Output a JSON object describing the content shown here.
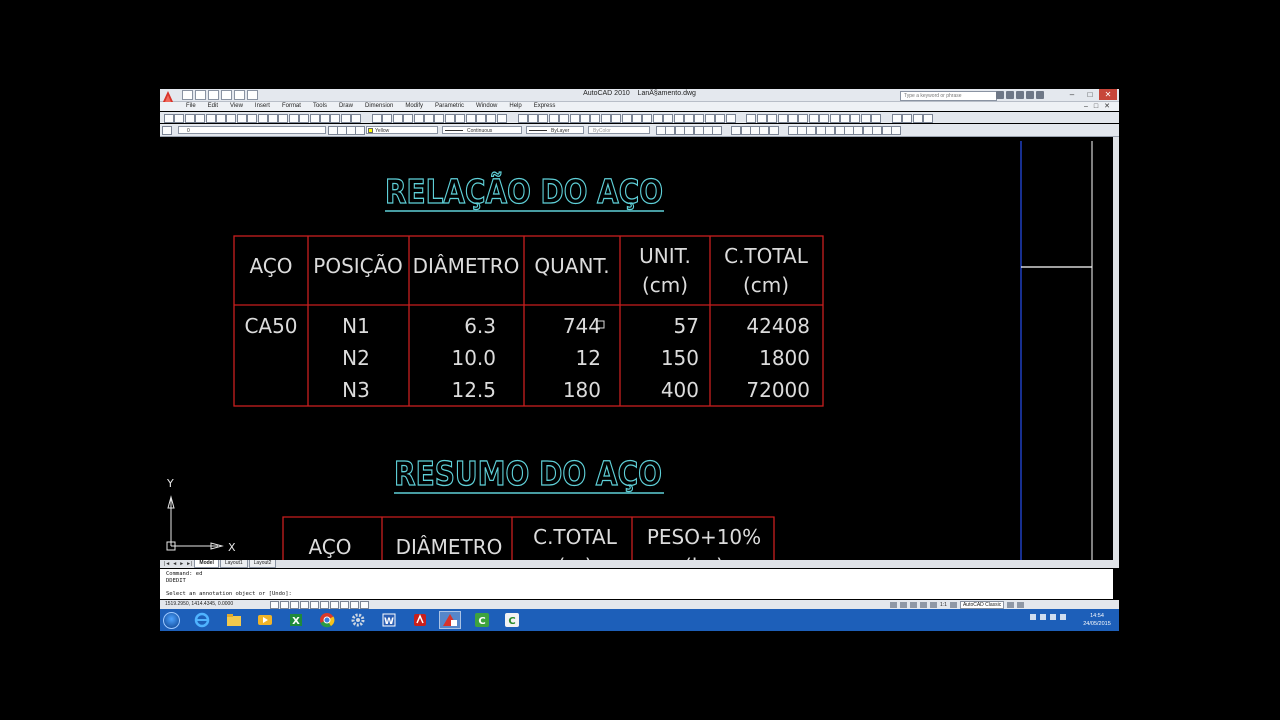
{
  "window": {
    "title": "AutoCAD 2010",
    "document": "LanÃ§amento.dwg"
  },
  "help_search": {
    "placeholder": "Type a keyword or phrase"
  },
  "menu": [
    "File",
    "Edit",
    "View",
    "Insert",
    "Format",
    "Tools",
    "Draw",
    "Dimension",
    "Modify",
    "Parametric",
    "Window",
    "Help",
    "Express"
  ],
  "properties": {
    "layer": "0",
    "color": "Yellow",
    "linetype": "Continuous",
    "lineweight": "ByLayer",
    "plotstyle": "ByColor"
  },
  "table1": {
    "title": "RELAÇÃO DO AÇO",
    "headers": [
      [
        "AÇO"
      ],
      [
        "POSIÇÃO"
      ],
      [
        "DIÂMETRO"
      ],
      [
        "QUANT."
      ],
      [
        "UNIT.",
        "(cm)"
      ],
      [
        "C.TOTAL",
        "(cm)"
      ]
    ],
    "steel": "CA50",
    "rows": [
      {
        "pos": "N1",
        "diam": "6.3",
        "quant": "744",
        "unit": "57",
        "total": "42408"
      },
      {
        "pos": "N2",
        "diam": "10.0",
        "quant": "12",
        "unit": "150",
        "total": "1800"
      },
      {
        "pos": "N3",
        "diam": "12.5",
        "quant": "180",
        "unit": "400",
        "total": "72000"
      }
    ]
  },
  "table2": {
    "title": "RESUMO DO AÇO",
    "headers": [
      [
        "AÇO"
      ],
      [
        "DIÂMETRO"
      ],
      [
        "C.TOTAL",
        "(m)"
      ],
      [
        "PESO+10%",
        "(kg)"
      ]
    ]
  },
  "ucs": {
    "x": "X",
    "y": "Y"
  },
  "layout_tabs": [
    "Model",
    "Layout1",
    "Layout2"
  ],
  "command_lines": [
    "Command: ed",
    "DDEDIT",
    "Select an annotation object or [Undo]:"
  ],
  "status": {
    "coords": "1519.2950, 1414.4345, 0.0000",
    "scale": "1:1",
    "workspace": "AutoCAD Classic"
  },
  "clock": {
    "time": "14:54",
    "date": "24/05/2015"
  },
  "colors": {
    "title_cyan": "#5fd0d8",
    "table_red": "#c81e1e",
    "text_light": "#dcdcdc",
    "taskbar": "#1d5fb9"
  }
}
